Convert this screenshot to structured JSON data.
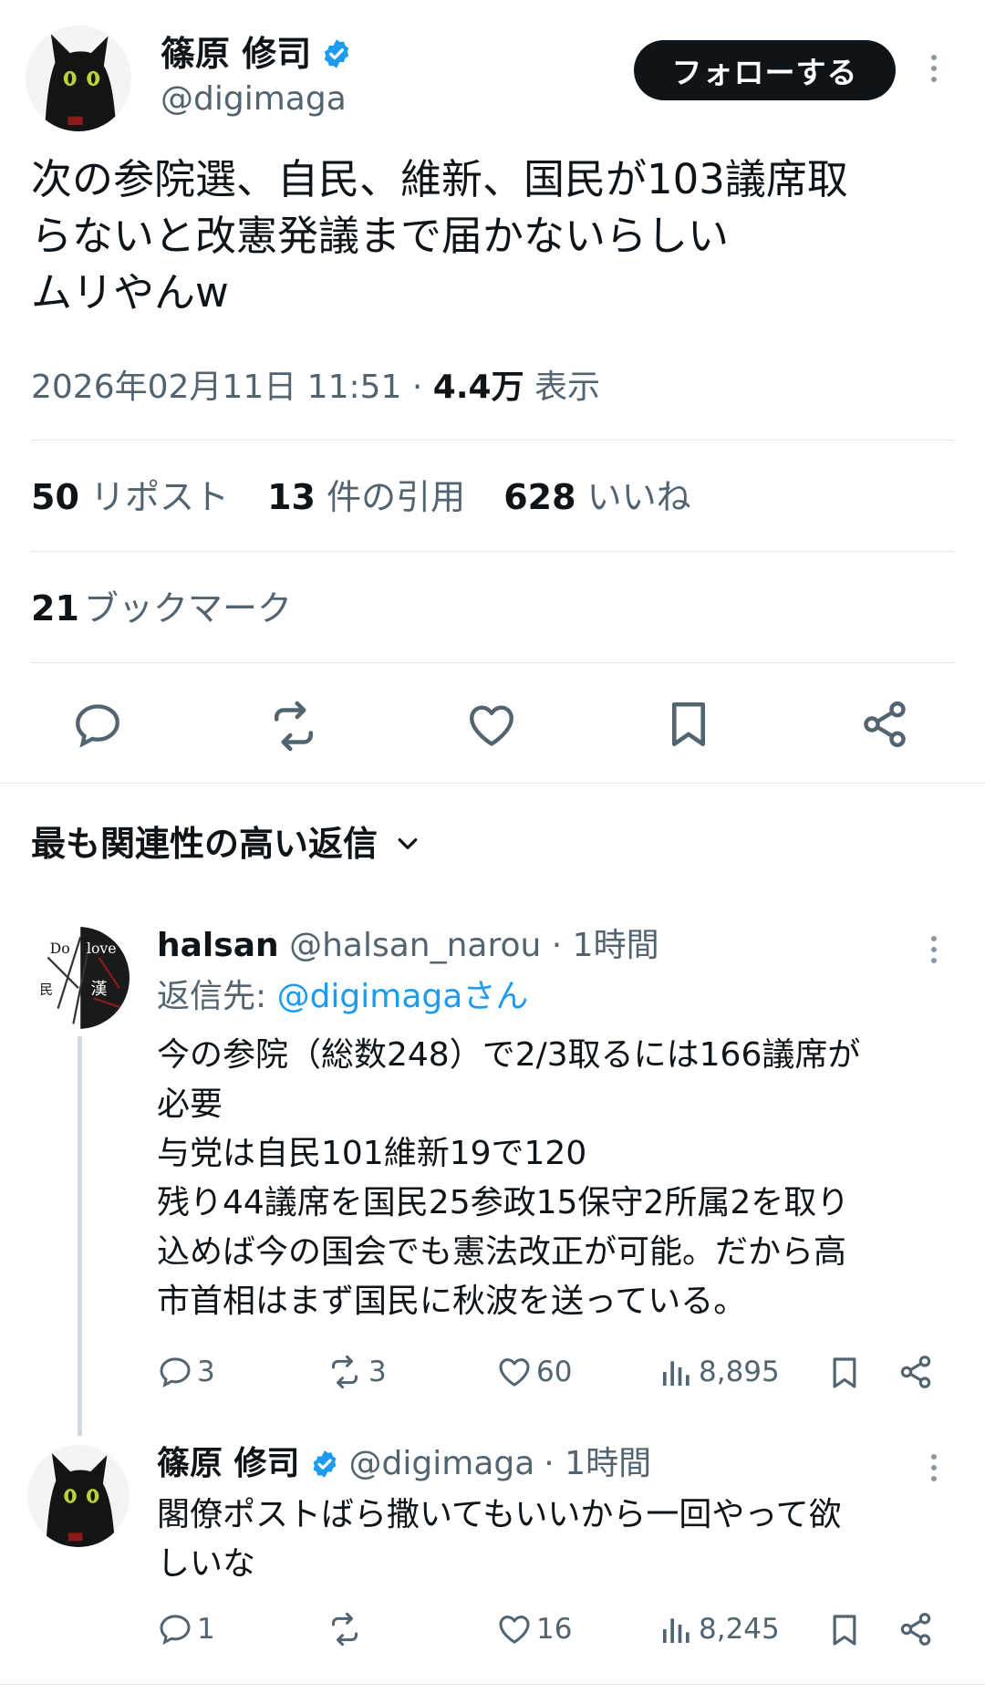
{
  "main_tweet": {
    "author_name": "篠原 修司",
    "author_handle": "@digimaga",
    "follow_label": "フォローする",
    "text_lines": [
      "次の参院選、自民、維新、国民が103議席取",
      "らないと改憲発議まで届かないらしい",
      "ムリやんw"
    ],
    "timestamp": "2026年02月11日 11:51",
    "separator": "·",
    "views_count": "4.4万",
    "views_label": "表示",
    "reposts_count": "50",
    "reposts_label": "リポスト",
    "quotes_count": "13",
    "quotes_label": "件の引用",
    "likes_count": "628",
    "likes_label": "いいね",
    "bookmarks_count": "21",
    "bookmarks_label": "ブックマーク"
  },
  "replies_header": {
    "label": "最も関連性の高い返信"
  },
  "replies": [
    {
      "author_name": "halsan",
      "author_handle": "@halsan_narou",
      "time": "· 1時間",
      "reply_to_prefix": "返信先: ",
      "reply_to_handle": "@digimagaさん",
      "text_lines": [
        "今の参院（総数248）で2/3取るには166議席が",
        "必要",
        "与党は自民101維新19で120",
        "残り44議席を国民25参政15保守2所属2を取り",
        "込めば今の国会でも憲法改正が可能。だから高",
        "市首相はまず国民に秋波を送っている。"
      ],
      "replies_count": "3",
      "reposts_count": "3",
      "likes_count": "60",
      "views_count": "8,895"
    },
    {
      "author_name": "篠原 修司",
      "author_handle": "@digimaga",
      "time": "· 1時間",
      "text_lines": [
        "閣僚ポストばら撒いてもいいから一回やって欲",
        "しいな"
      ],
      "replies_count": "1",
      "reposts_count": "",
      "likes_count": "16",
      "views_count": "8,245"
    }
  ],
  "colors": {
    "text": "#0f1419",
    "muted": "#536471",
    "link": "#1d9bf0",
    "verified": "#1d9bf0",
    "divider": "#e4e6e8",
    "follow_bg": "#0f1419"
  },
  "icons": {
    "verified": "verified-badge-icon",
    "more": "more-dots-icon",
    "reply": "reply-icon",
    "repost": "repost-icon",
    "like": "heart-icon",
    "bookmark": "bookmark-icon",
    "share": "share-icon",
    "views": "views-chart-icon",
    "chevron": "chevron-down-icon"
  }
}
